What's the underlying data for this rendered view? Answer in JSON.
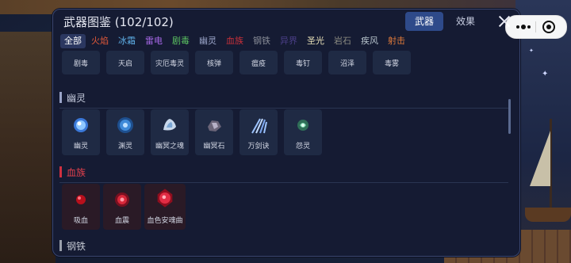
{
  "header": {
    "title": "武器图鉴 (102/102)"
  },
  "tabs": [
    {
      "label": "武器",
      "active": true
    },
    {
      "label": "效果",
      "active": false
    }
  ],
  "filters": [
    {
      "label": "全部",
      "color": "#ffffff",
      "active": true
    },
    {
      "label": "火焰",
      "color": "#e0583a"
    },
    {
      "label": "冰霜",
      "color": "#5fb0e8"
    },
    {
      "label": "雷电",
      "color": "#a868e8"
    },
    {
      "label": "剧毒",
      "color": "#5ac060"
    },
    {
      "label": "幽灵",
      "color": "#9aa4c8"
    },
    {
      "label": "血族",
      "color": "#c8303a"
    },
    {
      "label": "钢铁",
      "color": "#8a8e98"
    },
    {
      "label": "异界",
      "color": "#4a3e86"
    },
    {
      "label": "圣光",
      "color": "#e8e0b8"
    },
    {
      "label": "岩石",
      "color": "#8a8a80"
    },
    {
      "label": "疾风",
      "color": "#b8c4cc"
    },
    {
      "label": "射击",
      "color": "#e07a3a"
    }
  ],
  "sections": {
    "prev_row": [
      {
        "name": "剧毒",
        "icon": "poison-icon"
      },
      {
        "name": "天启",
        "icon": "apocalypse-icon"
      },
      {
        "name": "灾厄毒灵",
        "icon": "plague-spirit-icon"
      },
      {
        "name": "核弹",
        "icon": "nuke-icon"
      },
      {
        "name": "瘟疫",
        "icon": "plague-icon"
      },
      {
        "name": "毒钉",
        "icon": "poison-spike-icon"
      },
      {
        "name": "沼泽",
        "icon": "swamp-icon"
      },
      {
        "name": "毒雾",
        "icon": "poison-fog-icon"
      }
    ],
    "ghost": {
      "title": "幽灵",
      "color": "#9aa4c8",
      "items": [
        {
          "name": "幽灵",
          "icon": "ghost-orb-icon"
        },
        {
          "name": "渊灵",
          "icon": "abyss-spirit-icon"
        },
        {
          "name": "幽冥之魂",
          "icon": "nether-soul-icon"
        },
        {
          "name": "幽冥石",
          "icon": "nether-stone-icon"
        },
        {
          "name": "万剑诀",
          "icon": "sword-array-icon"
        },
        {
          "name": "怨灵",
          "icon": "wraith-icon"
        }
      ]
    },
    "blood": {
      "title": "血族",
      "color": "#d03040",
      "items": [
        {
          "name": "吸血",
          "icon": "blood-drop-icon"
        },
        {
          "name": "血震",
          "icon": "blood-quake-icon"
        },
        {
          "name": "血色安魂曲",
          "icon": "blood-requiem-icon"
        }
      ]
    },
    "steel": {
      "title": "钢铁",
      "color": "#9aa0ac"
    }
  }
}
